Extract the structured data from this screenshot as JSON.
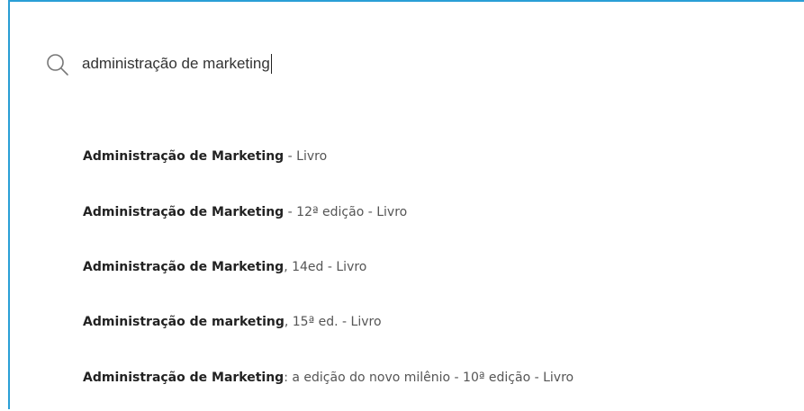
{
  "search": {
    "value": "administração de marketing",
    "placeholder": ""
  },
  "results": [
    {
      "title": "Administração de Marketing",
      "rest": " - Livro"
    },
    {
      "title": "Administração de Marketing",
      "rest": " - 12ª edição - Livro"
    },
    {
      "title": "Administração de Marketing",
      "rest": ", 14ed - Livro"
    },
    {
      "title": "Administração de marketing",
      "rest": ", 15ª ed. - Livro"
    },
    {
      "title": "Administração de Marketing",
      "rest": ": a edição do novo milênio - 10ª edição - Livro"
    }
  ],
  "colors": {
    "accent_border": "#2a9fd6",
    "text": "#222222",
    "icon": "#777777"
  },
  "icons": {
    "search": "search-icon"
  }
}
